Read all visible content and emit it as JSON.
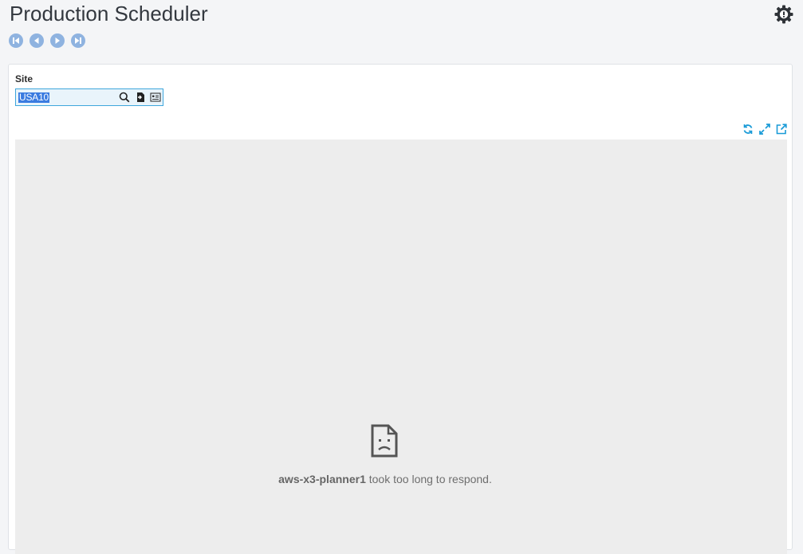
{
  "header": {
    "title": "Production Scheduler",
    "settings_icon": "gear-icon"
  },
  "navigation": {
    "buttons": [
      {
        "name": "first-record",
        "icon": "skip-first-icon"
      },
      {
        "name": "previous-record",
        "icon": "previous-icon"
      },
      {
        "name": "next-record",
        "icon": "next-icon"
      },
      {
        "name": "last-record",
        "icon": "skip-last-icon"
      }
    ]
  },
  "form": {
    "site": {
      "label": "Site",
      "value": "USA10",
      "icons": [
        "search-icon",
        "select-entry-icon",
        "detail-card-icon"
      ]
    }
  },
  "panel": {
    "tools": [
      "refresh-icon",
      "expand-icon",
      "open-external-icon"
    ],
    "error": {
      "host": "aws-x3-planner1",
      "message": " took too long to respond."
    }
  },
  "colors": {
    "accent": "#1a9bd7",
    "nav": "#8fb3e0",
    "selection": "#3a7be0",
    "frame_bg": "#ededed"
  }
}
